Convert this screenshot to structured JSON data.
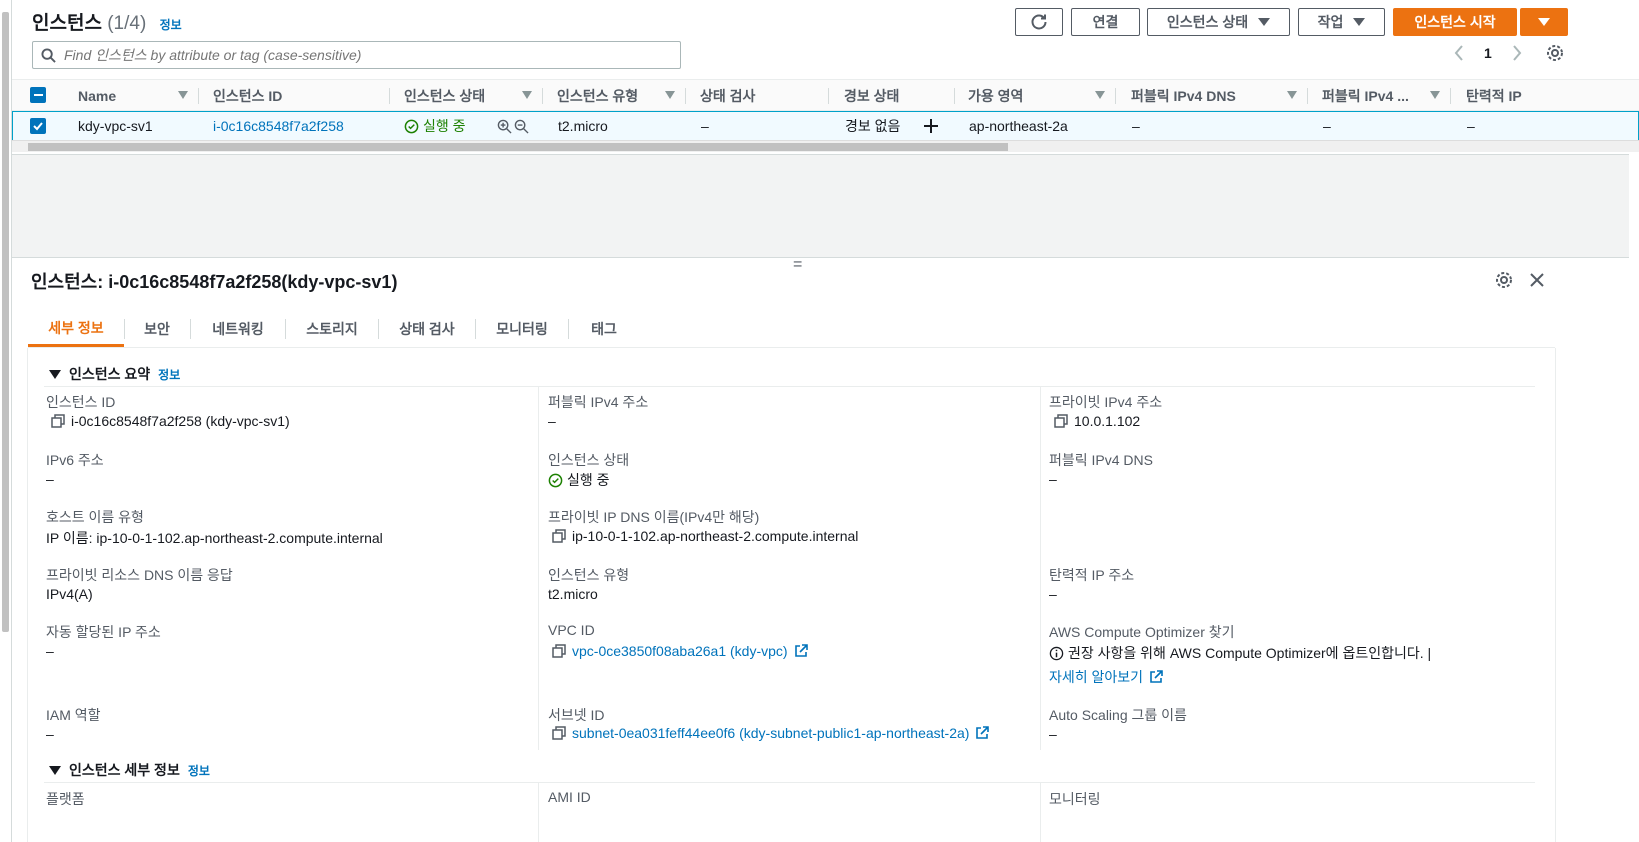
{
  "header": {
    "title": "인스턴스",
    "count": "(1/4)",
    "info": "정보",
    "buttons": {
      "connect": "연결",
      "state": "인스턴스 상태",
      "actions": "작업",
      "launch": "인스턴스 시작"
    },
    "search_placeholder": "Find 인스턴스 by attribute or tag (case-sensitive)",
    "page": "1"
  },
  "table": {
    "columns": [
      "Name",
      "인스턴스 ID",
      "인스턴스 상태",
      "인스턴스 유형",
      "상태 검사",
      "경보 상태",
      "가용 영역",
      "퍼블릭 IPv4 DNS",
      "퍼블릭 IPv4 ...",
      "탄력적 IP"
    ],
    "row": {
      "name": "kdy-vpc-sv1",
      "id": "i-0c16c8548f7a2f258",
      "state": "실행 중",
      "type": "t2.micro",
      "status_check": "–",
      "alarm": "경보 없음",
      "az": "ap-northeast-2a",
      "dns": "–",
      "ipv4": "–",
      "eip": "–"
    }
  },
  "detail": {
    "title_prefix": "인스턴스:",
    "title": "i-0c16c8548f7a2f258(kdy-vpc-sv1)",
    "tabs": [
      "세부 정보",
      "보안",
      "네트워킹",
      "스토리지",
      "상태 검사",
      "모니터링",
      "태그"
    ],
    "summary": {
      "heading": "인스턴스 요약",
      "info": "정보",
      "instance_id_label": "인스턴스 ID",
      "instance_id": "i-0c16c8548f7a2f258 (kdy-vpc-sv1)",
      "public_ipv4_label": "퍼블릭 IPv4 주소",
      "public_ipv4": "–",
      "private_ipv4_label": "프라이빗 IPv4 주소",
      "private_ipv4": "10.0.1.102",
      "ipv6_label": "IPv6 주소",
      "ipv6": "–",
      "state_label": "인스턴스 상태",
      "state": "실행 중",
      "public_dns_label": "퍼블릭 IPv4 DNS",
      "public_dns": "–",
      "hostname_type_label": "호스트 이름 유형",
      "hostname_type": "IP 이름: ip-10-0-1-102.ap-northeast-2.compute.internal",
      "private_dns_label": "프라이빗 IP DNS 이름(IPv4만 해당)",
      "private_dns": "ip-10-0-1-102.ap-northeast-2.compute.internal",
      "resource_dns_label": "프라이빗 리소스 DNS 이름 응답",
      "resource_dns": "IPv4(A)",
      "instance_type_label": "인스턴스 유형",
      "instance_type": "t2.micro",
      "eip_label": "탄력적 IP 주소",
      "eip": "–",
      "auto_ip_label": "자동 할당된 IP 주소",
      "auto_ip": "–",
      "vpc_label": "VPC ID",
      "vpc": "vpc-0ce3850f08aba26a1 (kdy-vpc)",
      "optimizer_label": "AWS Compute Optimizer 찾기",
      "optimizer_text": "권장 사항을 위해 AWS Compute Optimizer에 옵트인합니다. |",
      "optimizer_link": "자세히 알아보기",
      "iam_label": "IAM 역할",
      "iam": "–",
      "subnet_label": "서브넷 ID",
      "subnet": "subnet-0ea031feff44ee0f6 (kdy-subnet-public1-ap-northeast-2a)",
      "asg_label": "Auto Scaling 그룹 이름",
      "asg": "–"
    },
    "details_section": {
      "heading": "인스턴스 세부 정보",
      "info": "정보",
      "platform_label": "플랫폼",
      "ami_label": "AMI ID",
      "monitoring_label": "모니터링"
    }
  },
  "colors": {
    "primary": "#ec7211",
    "link": "#0073bb",
    "success": "#1d8102",
    "selected_row": "#f1faff"
  },
  "icons": [
    "refresh-icon",
    "search-icon",
    "chevron-left-icon",
    "chevron-right-icon",
    "settings-icon",
    "close-icon",
    "copy-icon",
    "external-link-icon",
    "info-icon",
    "status-ok-icon",
    "zoom-in-icon",
    "zoom-out-icon",
    "plus-icon"
  ]
}
